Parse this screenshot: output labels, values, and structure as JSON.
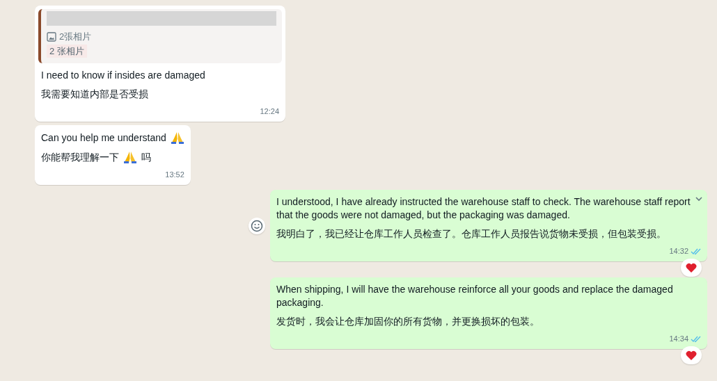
{
  "messages": [
    {
      "kind": "incoming",
      "hovered": false,
      "quote": {
        "caption": "2張相片",
        "translation": "2 张相片"
      },
      "lines": [
        [
          {
            "kind": "text",
            "text": "I need to know if insides are damaged"
          }
        ],
        [
          {
            "kind": "text",
            "text": "我需要知道内部是否受损"
          }
        ]
      ],
      "time": "12:24"
    },
    {
      "kind": "incoming",
      "hovered": false,
      "lines": [
        [
          {
            "kind": "text",
            "text": "Can you help me understand"
          },
          {
            "kind": "praying-hands"
          }
        ],
        [
          {
            "kind": "text",
            "text": "你能帮我理解一下"
          },
          {
            "kind": "praying-hands"
          },
          {
            "kind": "text",
            "text": "吗"
          }
        ]
      ],
      "time": "13:52"
    },
    {
      "kind": "outgoing",
      "hovered": true,
      "lines": [
        [
          {
            "kind": "text",
            "text": "I understood, I have already instructed the warehouse staff to check. The warehouse staff report\nthat the goods were not damaged, but the packaging was damaged."
          }
        ],
        [
          {
            "kind": "text",
            "text": "我明白了，我已经让仓库工作人员检查了。仓库工作人员报告说货物未受损，但包装受损。"
          }
        ]
      ],
      "time": "14:32",
      "read": true,
      "reaction": {
        "kind": "heart"
      }
    },
    {
      "kind": "outgoing",
      "hovered": false,
      "lines": [
        [
          {
            "kind": "text",
            "text": "When shipping, I will have the warehouse reinforce all your goods and replace the damaged packaging."
          }
        ],
        [
          {
            "kind": "text",
            "text": "发货时，我会让仓库加固你的所有货物，并更换损坏的包装。"
          }
        ]
      ],
      "time": "14:34",
      "read": true,
      "reaction": {
        "kind": "heart"
      }
    }
  ]
}
